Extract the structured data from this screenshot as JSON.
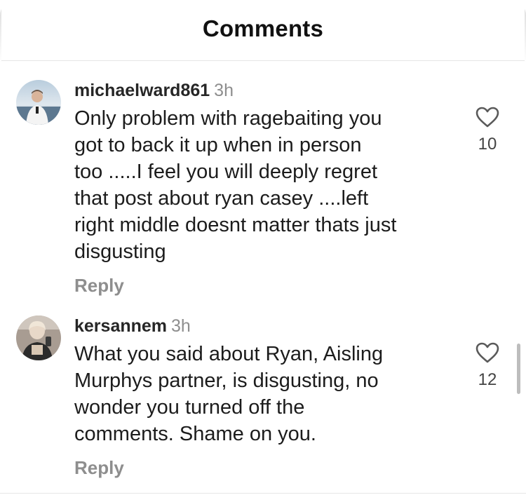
{
  "header": {
    "title": "Comments"
  },
  "comments": [
    {
      "username": "michaelward861",
      "time": "3h",
      "lines": [
        "Only problem with ragebaiting you",
        "got to back it up when in person",
        "too .....I feel you will deeply regret",
        "that post about ryan casey ....left",
        "right middle doesnt matter thats just",
        "disgusting"
      ],
      "likes": "10",
      "reply_label": "Reply",
      "like_icon": "heart-outline-icon"
    },
    {
      "username": "kersannem",
      "time": "3h",
      "lines": [
        "What you said about Ryan, Aisling",
        "Murphys partner, is disgusting, no",
        "wonder you turned off the",
        "comments. Shame on you."
      ],
      "likes": "12",
      "reply_label": "Reply",
      "like_icon": "heart-outline-icon"
    }
  ],
  "colors": {
    "username": "#262626",
    "secondary": "#8e8e8e",
    "divider": "#e6e6e6"
  }
}
